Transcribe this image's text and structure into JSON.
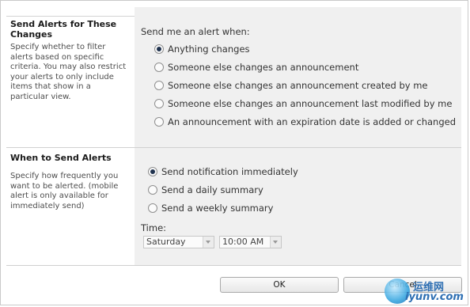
{
  "send_alerts_section": {
    "heading": "Send Alerts for These Changes",
    "description": "Specify whether to filter alerts based on specific criteria. You may also restrict your alerts to only include items that show in a particular view.",
    "prompt": "Send me an alert when:",
    "options": [
      {
        "label": "Anything changes",
        "checked": true
      },
      {
        "label": "Someone else changes an announcement",
        "checked": false
      },
      {
        "label": "Someone else changes an announcement created by me",
        "checked": false
      },
      {
        "label": "Someone else changes an announcement last modified by me",
        "checked": false
      },
      {
        "label": "An announcement with an expiration date is added or changed",
        "checked": false
      }
    ]
  },
  "when_section": {
    "heading": "When to Send Alerts",
    "description": "Specify how frequently you want to be alerted. (mobile alert is only available for immediately send)",
    "options": [
      {
        "label": "Send notification immediately",
        "checked": true
      },
      {
        "label": "Send a daily summary",
        "checked": false
      },
      {
        "label": "Send a weekly summary",
        "checked": false
      }
    ],
    "time_label": "Time:",
    "day_select": {
      "value": "Saturday"
    },
    "time_select": {
      "value": "10:00 AM"
    }
  },
  "buttons": {
    "ok": "OK",
    "cancel": "Cancel"
  },
  "watermark": {
    "line1": "运维网",
    "line2": "iyunv.com"
  }
}
